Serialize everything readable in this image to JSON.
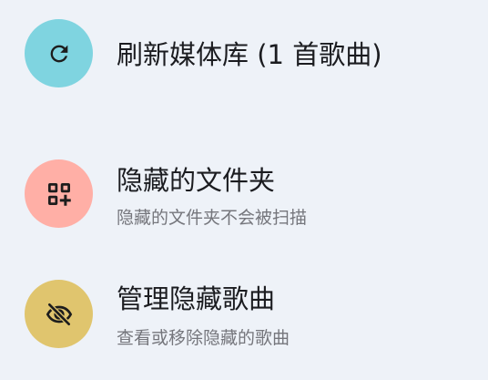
{
  "settings": {
    "items": [
      {
        "icon": "refresh-icon",
        "color": "#7fd4e0",
        "title": "刷新媒体库 (1 首歌曲)",
        "subtitle": ""
      },
      {
        "icon": "qr-add-icon",
        "color": "#ffafa6",
        "title": "隐藏的文件夹",
        "subtitle": "隐藏的文件夹不会被扫描"
      },
      {
        "icon": "eye-off-icon",
        "color": "#e0c56e",
        "title": "管理隐藏歌曲",
        "subtitle": "查看或移除隐藏的歌曲"
      }
    ]
  }
}
